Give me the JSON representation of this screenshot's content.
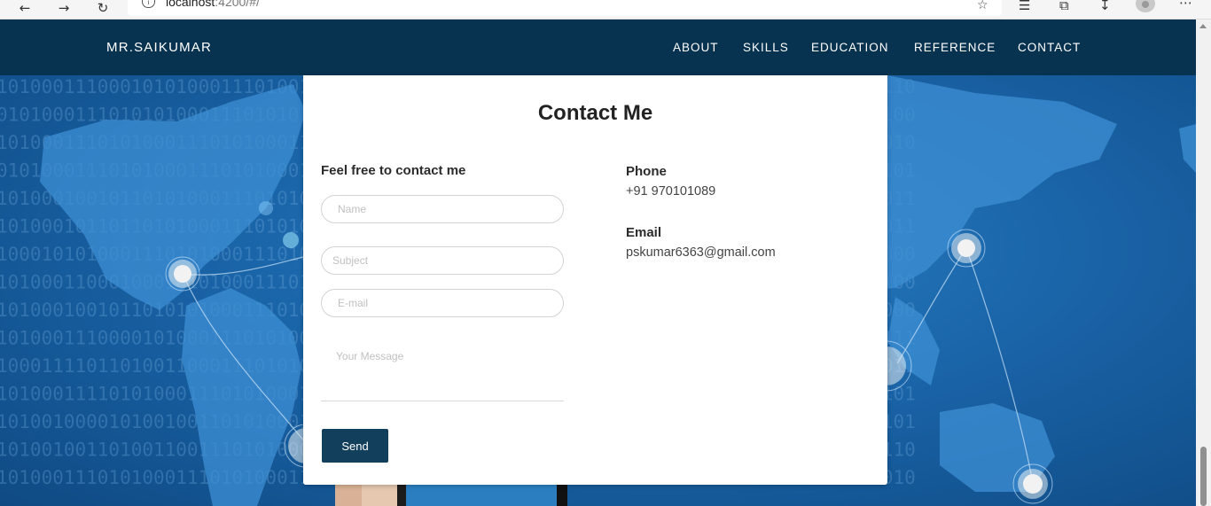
{
  "browser": {
    "url_host": "localhost",
    "url_rest": ":4200/#/"
  },
  "site": {
    "brand": "MR.SAIKUMAR",
    "nav": [
      "ABOUT",
      "SKILLS",
      "EDUCATION",
      "REFERENCE",
      "CONTACT"
    ]
  },
  "background": {
    "binary_rows": [
      "1010001110001010100011101001001010100011101010001110101000111010100011101010001110",
      "0101000111010101000111010101000111010101000111010100011101010001110101000111010100",
      "1010001110101000111010100011101010001110101000111010100011101010001110101000111010",
      "0101000111010100011101010001110101000111010100011101010001110101000111010100011101",
      "1010001001011010100011101010001110101000111010100011101010001110101000111010100011",
      "1010001011011010100011101010001110101000111010100011101010001110101000111010100011",
      "1000101010001110101000111010100011101010001110101000111010100011101010001110101000",
      "1010001100010001010100011101010001110101000111010100011101010001110101000111010100",
      "1010001001011010101000111010100011101010001110101000111010100011101010001110101000",
      "1010001110000101000111010100011101010001110101000111010100011101010001110101000111",
      "1000111101101001100011101010001110101000111010100011101010001110101000111010100011",
      "1010001111010100011101010001110101000111010100011101010001110101000111010100011101",
      "1010010000101001001101010001110101000111010100011101010001110101000111010100011101",
      "1010010011010011001110101000111010100011101010001110101000111010100011101010001110",
      "1010001110101000111010100011101010001110101000111010100011101010001110101000111010"
    ]
  },
  "contact": {
    "title": "Contact Me",
    "form_heading": "Feel free to contact me",
    "placeholders": {
      "name": "Name",
      "subject": "Subject",
      "email": "E-mail",
      "message": "Your Message"
    },
    "send_label": "Send",
    "phone_label": "Phone",
    "phone_value": "+91 970101089",
    "email_label": "Email",
    "email_value": "pskumar6363@gmail.com"
  },
  "colors": {
    "nav_bg": "#073350",
    "button_bg": "#123f5c",
    "card_bg": "#ffffff",
    "page_bg": "#1a64a8"
  },
  "icons": [
    "back-arrow-icon",
    "forward-arrow-icon",
    "refresh-icon",
    "info-icon",
    "reading-mode-icon",
    "favorites-icon",
    "collections-icon",
    "downloads-icon",
    "profile-avatar",
    "more-menu-icon"
  ]
}
